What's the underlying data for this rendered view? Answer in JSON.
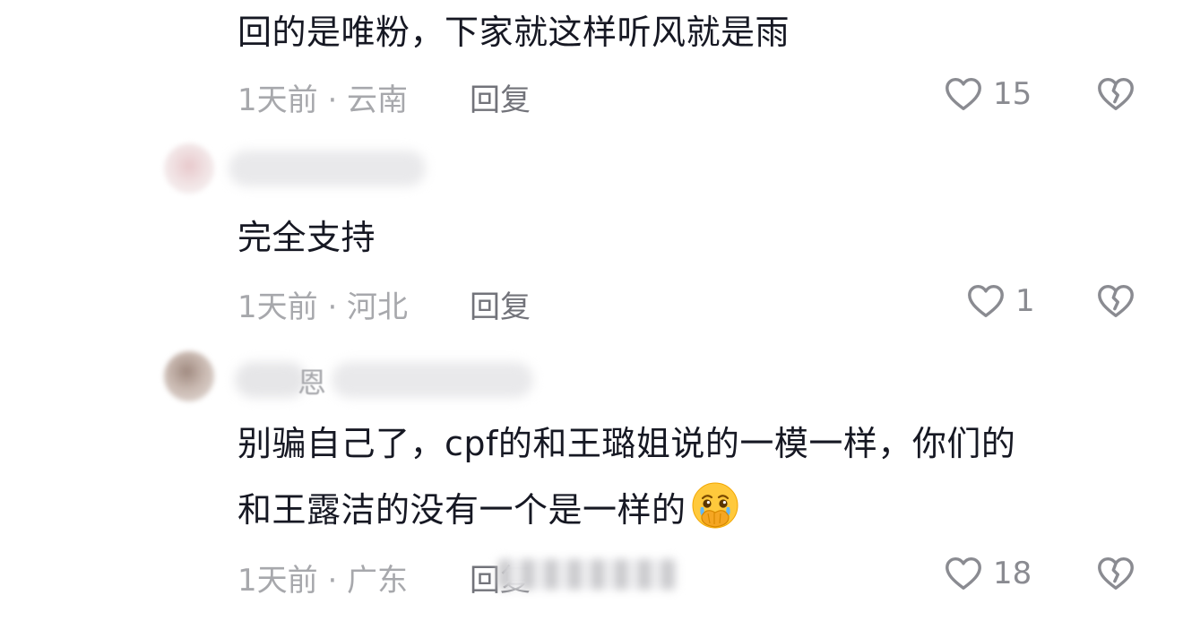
{
  "comments": [
    {
      "text": "回的是唯粉，下家就这样听风就是雨",
      "meta": "1天前 · 云南",
      "reply_label": "回复",
      "likes": "15",
      "dislike_icon": "broken-heart-icon",
      "like_icon": "heart-outline-icon"
    },
    {
      "text": "完全支持",
      "meta": "1天前 · 河北",
      "reply_label": "回复",
      "likes": "1",
      "dislike_icon": "broken-heart-icon",
      "like_icon": "heart-outline-icon"
    },
    {
      "author_visible_char": "恩",
      "text_line1": "别骗自己了，cpf的和王璐姐说的一模一样，你们的",
      "text_line2": "和王露洁的没有一个是一样的",
      "emoji": "crying-hands-over-mouth-emoji",
      "meta": "1天前 · 广东",
      "reply_label": "回复",
      "likes": "18",
      "dislike_icon": "broken-heart-icon",
      "like_icon": "heart-outline-icon"
    }
  ],
  "colors": {
    "text_primary": "#161823",
    "meta": "#a7a8ac",
    "reply": "#72737a",
    "icon": "#8a8b91"
  }
}
